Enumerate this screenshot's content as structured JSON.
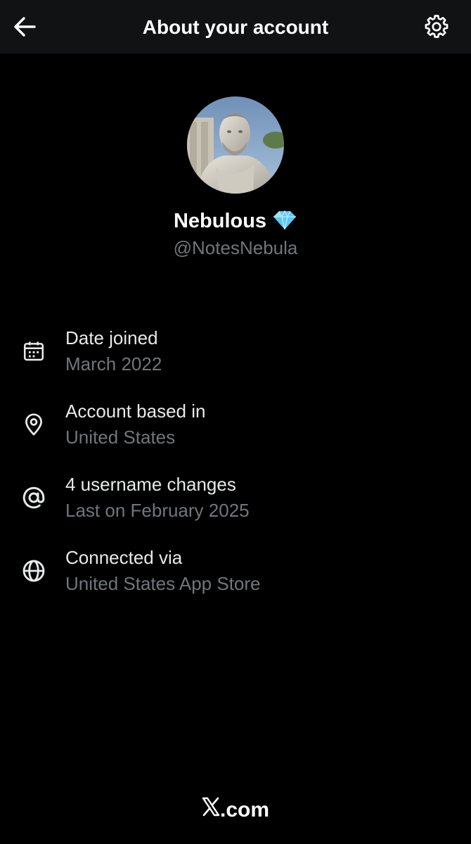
{
  "header": {
    "title": "About your account"
  },
  "profile": {
    "display_name": "Nebulous",
    "badge_icon": "diamond-icon",
    "handle": "@NotesNebula"
  },
  "details": [
    {
      "icon": "calendar-icon",
      "label": "Date joined",
      "value": "March 2022"
    },
    {
      "icon": "location-pin-icon",
      "label": "Account based in",
      "value": "United States"
    },
    {
      "icon": "at-sign-icon",
      "label": "4 username changes",
      "value": "Last on February 2025"
    },
    {
      "icon": "globe-icon",
      "label": "Connected via",
      "value": "United States App Store"
    }
  ],
  "footer": {
    "brand_text": ".com",
    "logo_icon": "x-logo-icon"
  },
  "colors": {
    "background": "#000000",
    "header_background": "#111214",
    "primary_text": "#e7e9ea",
    "secondary_text": "#71767b",
    "badge": "#5fc8f5"
  }
}
